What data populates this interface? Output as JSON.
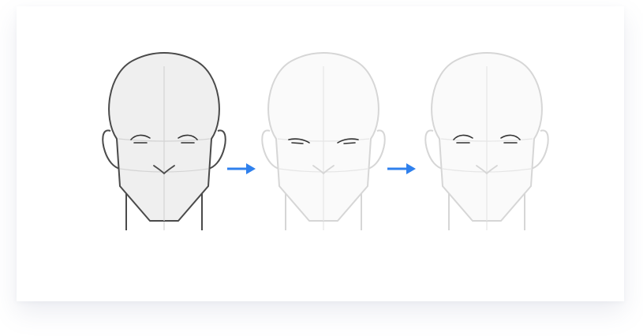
{
  "diagram": {
    "steps": [
      {
        "state": "active",
        "eyes": "open",
        "stroke": "#4a4a4a",
        "fill": "#efefef",
        "guide": "#d4d4d4"
      },
      {
        "state": "faded",
        "eyes": "closed",
        "stroke": "#d6d6d6",
        "fill": "#fafafa",
        "guide": "#e6e6e6"
      },
      {
        "state": "faded",
        "eyes": "open",
        "stroke": "#d6d6d6",
        "fill": "#fafafa",
        "guide": "#e6e6e6"
      }
    ],
    "feature_stroke": "#333333",
    "arrow_color": "#2f80ed",
    "arrow_count": 2
  }
}
